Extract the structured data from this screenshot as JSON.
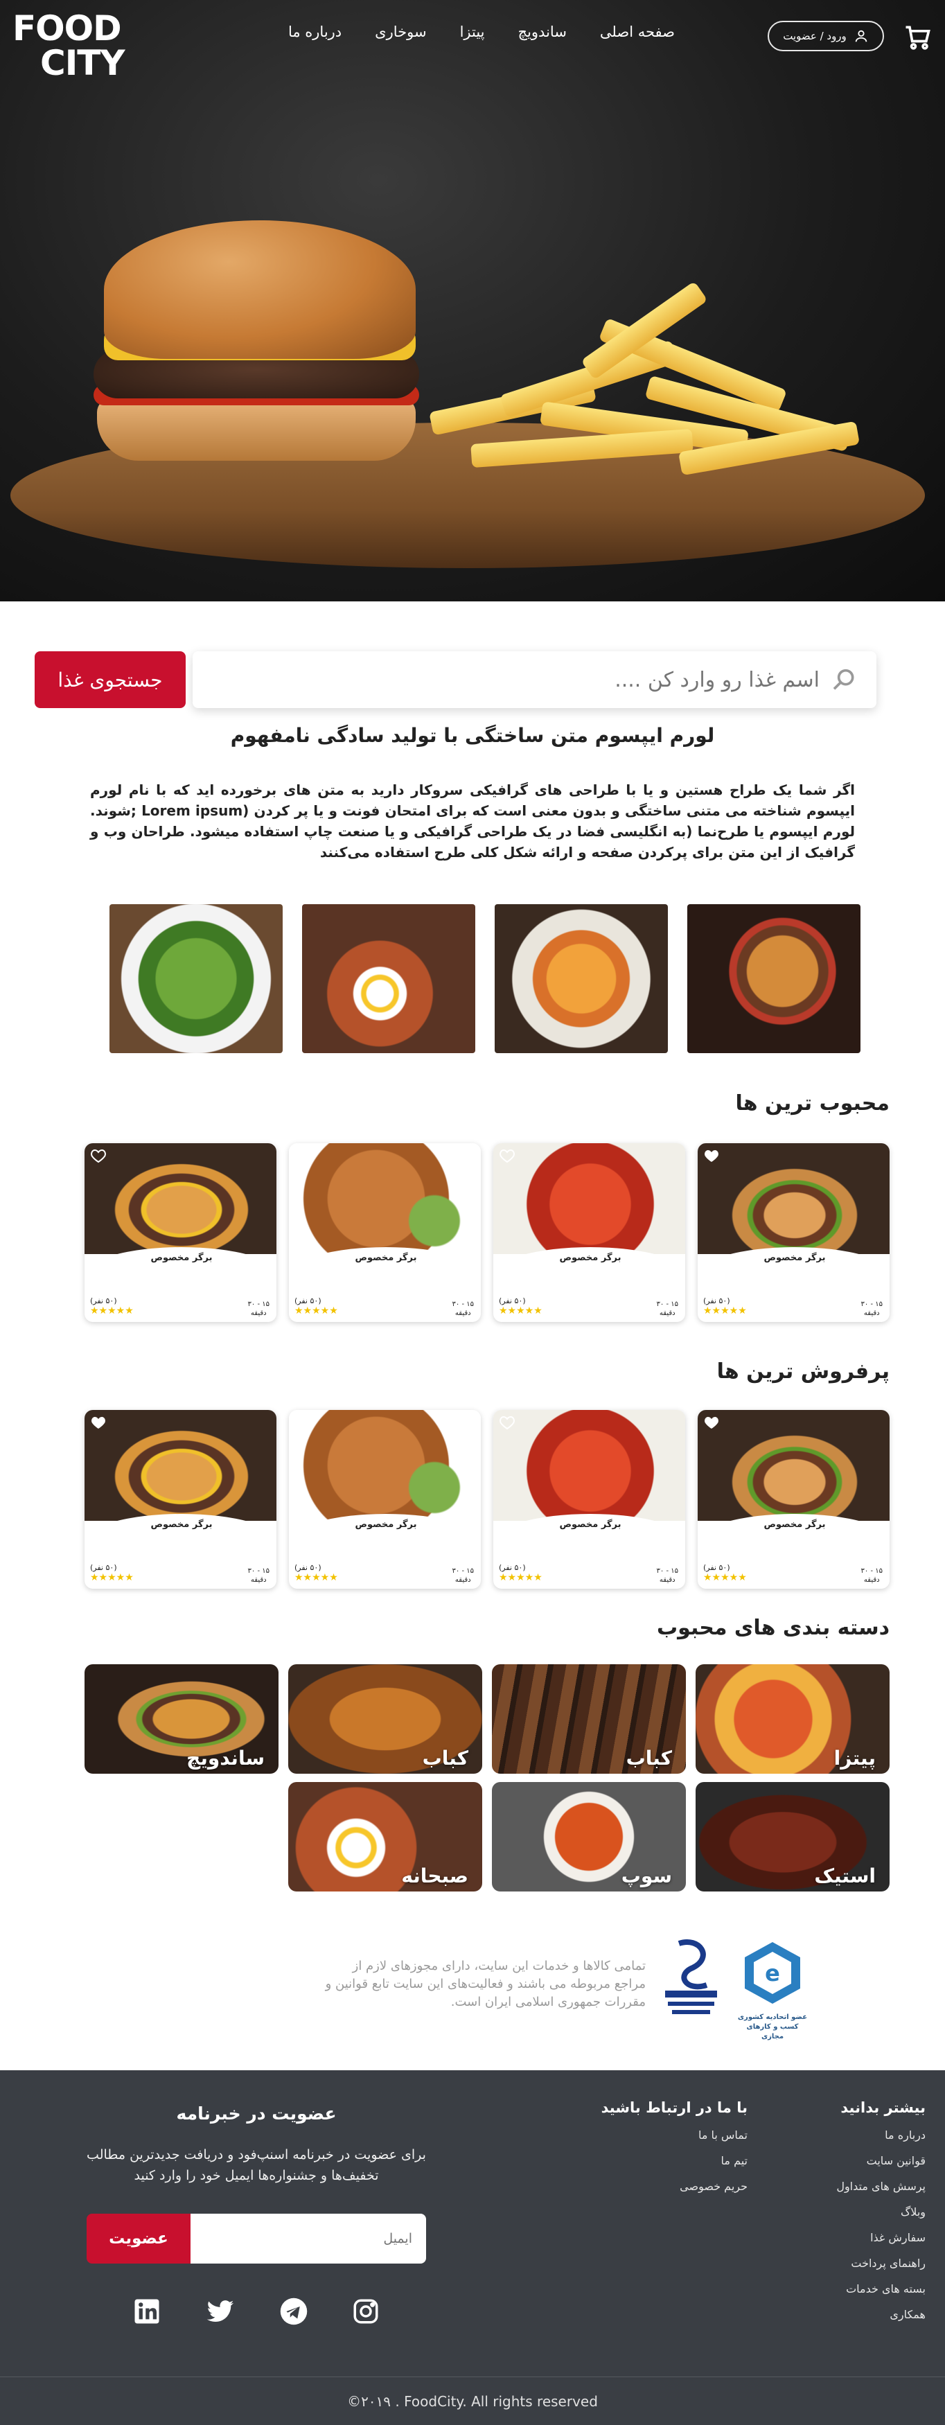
{
  "header": {
    "logo_line1": "FOOD",
    "logo_line2": "CITY",
    "login_label": "ورود / عضویت",
    "menu": [
      {
        "label": "صفحه اصلی"
      },
      {
        "label": "ساندویچ"
      },
      {
        "label": "پیتزا"
      },
      {
        "label": "سوخاری"
      },
      {
        "label": "درباره ما"
      }
    ]
  },
  "search": {
    "placeholder": "اسم غذا رو وارد کن ....",
    "button_label": "جستجوی غذا"
  },
  "intro": {
    "title": "لورم ایپسوم متن ساختگی با تولید سادگی نامفهوم",
    "body": "اگر شما یک طراح هستین و یا با طراحی های گرافیکی سروکار دارید به متن های برخورده اید که با نام لورم ایپسوم شناخته می متنی ساختگی و بدون معنی است که برای امتحان فونت و یا پر کردن (Lorem ipsum ;شوند. لورم ایپسوم یا طرح‌نما (به انگلیسی فضا در یک طراحی گرافیکی و یا صنعت چاپ استفاده میشود. طراحان وب و گرافیک از این متن برای پرکردن صفحه و ارائه شکل کلی طرح استفاده می‌کنند"
  },
  "sections": {
    "popular_title": "محبوب ترین ها",
    "bestseller_title": "پرفروش ترین ها",
    "categories_title": "دسته بندی های محبوب"
  },
  "popular_cards": [
    {
      "name": "برگر مخصوص",
      "votes": "(۵۰ نفر)",
      "time": "۱۵ - ۳۰",
      "time_unit": "دقیقه",
      "stars": "★★★★★"
    },
    {
      "name": "برگر مخصوص",
      "votes": "(۵۰ نفر)",
      "time": "۱۵ - ۳۰",
      "time_unit": "دقیقه",
      "stars": "★★★★★"
    },
    {
      "name": "برگر مخصوص",
      "votes": "(۵۰ نفر)",
      "time": "۱۵ - ۳۰",
      "time_unit": "دقیقه",
      "stars": "★★★★★"
    },
    {
      "name": "برگر مخصوص",
      "votes": "(۵۰ نفر)",
      "time": "۱۵ - ۳۰",
      "time_unit": "دقیقه",
      "stars": "★★★★★"
    }
  ],
  "bestseller_cards": [
    {
      "name": "برگر مخصوص",
      "votes": "(۵۰ نفر)",
      "time": "۱۵ - ۳۰",
      "time_unit": "دقیقه",
      "stars": "★★★★★"
    },
    {
      "name": "برگر مخصوص",
      "votes": "(۵۰ نفر)",
      "time": "۱۵ - ۳۰",
      "time_unit": "دقیقه",
      "stars": "★★★★★"
    },
    {
      "name": "برگر مخصوص",
      "votes": "(۵۰ نفر)",
      "time": "۱۵ - ۳۰",
      "time_unit": "دقیقه",
      "stars": "★★★★★"
    },
    {
      "name": "برگر مخصوص",
      "votes": "(۵۰ نفر)",
      "time": "۱۵ - ۳۰",
      "time_unit": "دقیقه",
      "stars": "★★★★★"
    }
  ],
  "categories": [
    {
      "label": "پیتزا"
    },
    {
      "label": "کباب"
    },
    {
      "label": "کباب"
    },
    {
      "label": "ساندویچ"
    },
    {
      "label": "استیک"
    },
    {
      "label": "سوپ"
    },
    {
      "label": "صبحانه"
    }
  ],
  "trust": {
    "text": "تمامی کالاها و خدمات این سایت، دارای مجوزهای لازم از مراجع مربوطه می باشند و فعالیت‌های این سایت تابع قوانین و مقررات جمهوری اسلامی ایران است.",
    "enamad_caption": "عضو اتحادیه کشوری کسب و کارهای مجازی"
  },
  "footer": {
    "col1_title": "بیشتر بدانید",
    "col1_links": [
      "درباره ما",
      "قوانین سایت",
      "پرسش های متداول",
      "وبلاگ",
      "سفارش غذا",
      "راهنمای پرداخت",
      "بسته های خدمات",
      "همکاری"
    ],
    "col2_title": "با ما در ارتباط باشید",
    "col2_links": [
      "تماس با ما",
      "تیم ما",
      "حریم خصوصی"
    ],
    "newsletter_title": "عضویت در خبرنامه",
    "newsletter_text": "برای عضویت در خبرنامه اسنپ‌فود و دریافت جدیدترین مطالب تخفیف‌ها و جشنواره‌ها ایمیل خود را وارد کنید",
    "email_placeholder": "ایمیل",
    "subscribe_label": "عضویت",
    "copyright": "©۲۰۱۹ . FoodCity. All rights reserved"
  },
  "colors": {
    "accent": "#c8102e",
    "footer_bg": "#3a3e44"
  }
}
